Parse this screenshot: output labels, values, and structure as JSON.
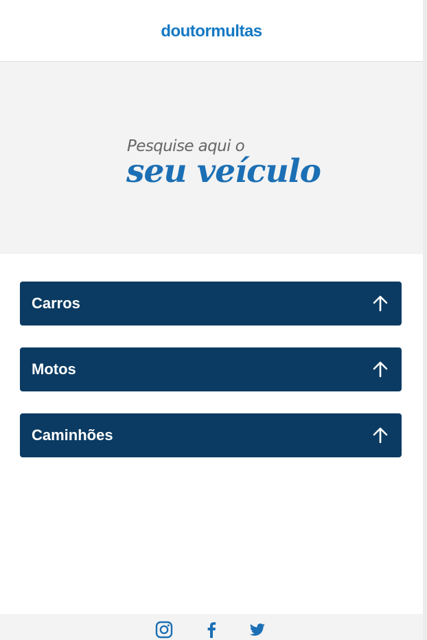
{
  "header": {
    "logo_text": "doutormultas"
  },
  "hero": {
    "line1": "Pesquise aqui o",
    "line2": "seu veículo"
  },
  "vehicle_categories": [
    {
      "label": "Carros",
      "icon": "arrow-up-icon"
    },
    {
      "label": "Motos",
      "icon": "arrow-up-icon"
    },
    {
      "label": "Caminhões",
      "icon": "arrow-up-icon"
    }
  ],
  "footer": {
    "social_icons": [
      "instagram-icon",
      "facebook-icon",
      "twitter-icon"
    ]
  },
  "colors": {
    "brand_blue": "#1479c4",
    "button_navy": "#0b3b62",
    "hero_script_blue": "#1c6fb4",
    "hero_bg": "#f3f3f3"
  }
}
